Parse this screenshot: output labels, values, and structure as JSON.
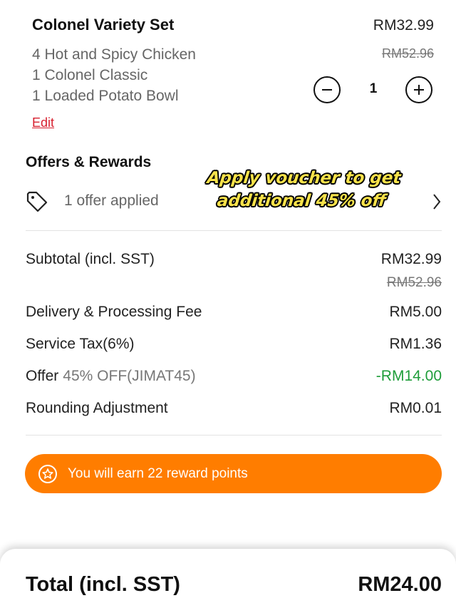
{
  "item": {
    "name": "Colonel Variety Set",
    "price": "RM32.99",
    "original_price": "RM52.96",
    "components": [
      "4 Hot and Spicy Chicken",
      "1 Colonel Classic",
      "1 Loaded Potato Bowl"
    ],
    "edit_label": "Edit",
    "quantity": "1",
    "decrease_icon": "minus-circle-icon",
    "increase_icon": "plus-circle-icon"
  },
  "offers": {
    "title": "Offers & Rewards",
    "applied_text": "1 offer applied",
    "icon": "tag-icon",
    "chevron": "chevron-right-icon"
  },
  "caption": {
    "line1": "Apply voucher to get",
    "line2": "additional 45% off"
  },
  "summary": {
    "subtotal_label": "Subtotal (incl. SST)",
    "subtotal_value": "RM32.99",
    "subtotal_original": "RM52.96",
    "delivery_label": "Delivery & Processing Fee",
    "delivery_value": "RM5.00",
    "tax_label": "Service Tax(6%)",
    "tax_value": "RM1.36",
    "offer_label": "Offer",
    "offer_code": "45% OFF(JIMAT45)",
    "offer_value": "-RM14.00",
    "rounding_label": "Rounding Adjustment",
    "rounding_value": "RM0.01"
  },
  "reward": {
    "text": "You will earn 22 reward points",
    "icon": "star-badge-icon",
    "color": "#ff7d00"
  },
  "total": {
    "label": "Total (incl. SST)",
    "value": "RM24.00"
  },
  "colors": {
    "accent": "#ff7d00",
    "discount": "#1f9d3a",
    "edit_link": "#d7202f",
    "caption": "#f7e24a"
  }
}
